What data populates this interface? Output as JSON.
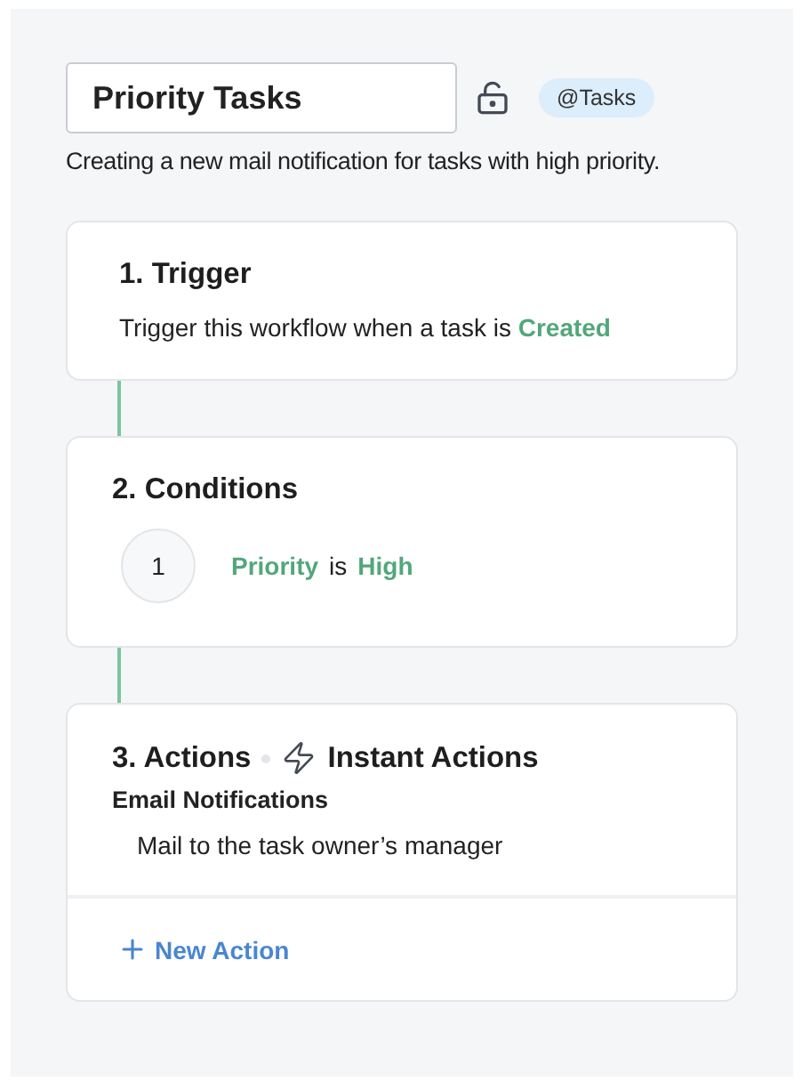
{
  "workflow": {
    "name": "Priority Tasks",
    "locked": false,
    "module_tag": "@Tasks",
    "description": "Creating a new mail notification for tasks with high priority."
  },
  "trigger": {
    "title": "1. Trigger",
    "text": "Trigger this workflow when a task is",
    "event": "Created"
  },
  "conditions": {
    "title": "2. Conditions",
    "items": [
      {
        "number": "1",
        "field": "Priority",
        "operator": "is",
        "value": "High"
      }
    ]
  },
  "actions": {
    "title": "3. Actions",
    "mode": "Instant Actions",
    "groups": [
      {
        "heading": "Email Notifications",
        "items": [
          "Mail to the task owner’s manager"
        ]
      }
    ],
    "add_button": "New Action"
  }
}
